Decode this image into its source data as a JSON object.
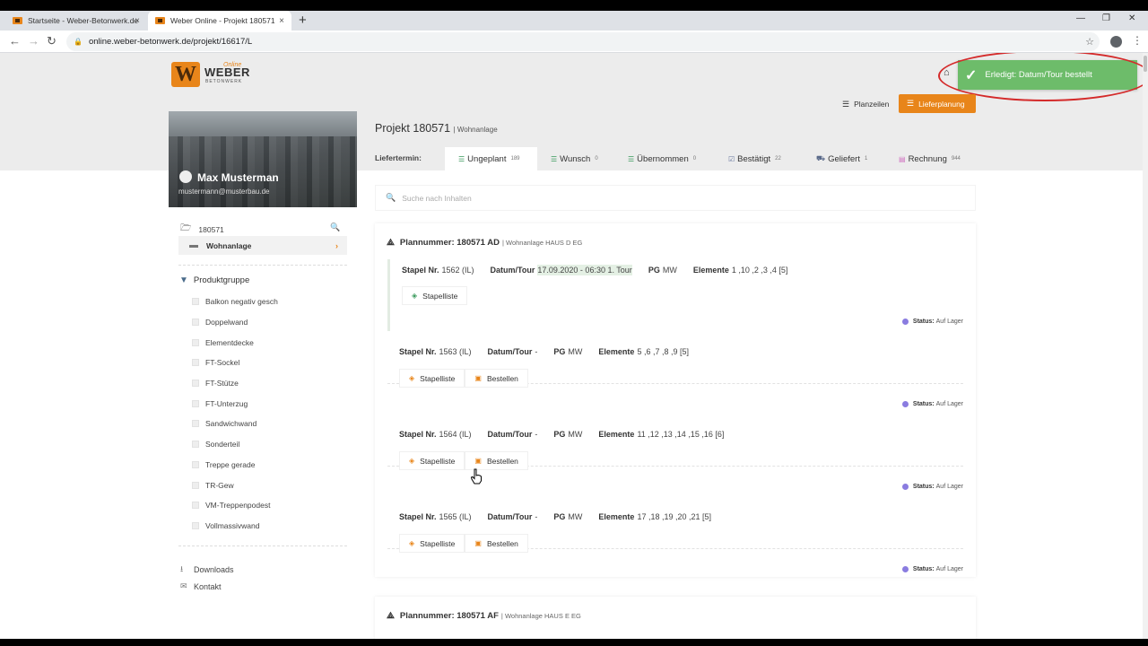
{
  "browser": {
    "tabs": [
      {
        "title": "Startseite - Weber-Betonwerk.de",
        "active": false
      },
      {
        "title": "Weber Online - Projekt 180571",
        "active": true
      }
    ],
    "url": "online.weber-betonwerk.de/projekt/16617/L",
    "new_tab_label": "+",
    "close_label": "×"
  },
  "brand": {
    "logo_letter": "W",
    "name": "WEBER",
    "online": "Online",
    "sub": "BETONWERK",
    "accent_color": "#e8851a"
  },
  "toast": {
    "message": "Erledigt: Datum/Tour bestellt",
    "color": "#6dbc6a"
  },
  "header_buttons": {
    "planzeilen": "Planzeilen",
    "lieferplanung": "Lieferplanung"
  },
  "user": {
    "name": "Max Musterman",
    "email": "mustermann@musterbau.de"
  },
  "sidebar": {
    "project": "180571",
    "subproject": "Wohnanlage",
    "group_title": "Produktgruppe",
    "filters": [
      "Balkon negativ gesch",
      "Doppelwand",
      "Elementdecke",
      "FT-Sockel",
      "FT-Stütze",
      "FT-Unterzug",
      "Sandwichwand",
      "Sonderteil",
      "Treppe gerade",
      "TR-Gew",
      "VM-Treppenpodest",
      "Vollmassivwand"
    ],
    "downloads": "Downloads",
    "kontakt": "Kontakt"
  },
  "main": {
    "project_title": "Projekt 180571",
    "project_sub": "| Wohnanlage",
    "liefertermin_label": "Liefertermin:",
    "status_tabs": [
      {
        "label": "Ungeplant",
        "count": "189",
        "icon": "stack-icon",
        "color": "#3a9a5c",
        "active": true
      },
      {
        "label": "Wunsch",
        "count": "0",
        "icon": "stack-icon",
        "color": "#3a9a5c",
        "active": false
      },
      {
        "label": "Übernommen",
        "count": "0",
        "icon": "stack-icon",
        "color": "#3a9a5c",
        "active": false
      },
      {
        "label": "Bestätigt",
        "count": "22",
        "icon": "checklist-icon",
        "color": "#6a7aa0",
        "active": false
      },
      {
        "label": "Geliefert",
        "count": "1",
        "icon": "truck-icon",
        "color": "#5a6a8a",
        "active": false
      },
      {
        "label": "Rechnung",
        "count": "944",
        "icon": "invoice-icon",
        "color": "#d070c0",
        "active": false
      }
    ],
    "search_placeholder": "Suche nach Inhalten",
    "plans": [
      {
        "title": "Plannummer: 180571 AD",
        "sub": "| Wohnanlage HAUS D EG",
        "stapel": [
          {
            "stapel_label": "Stapel Nr.",
            "stapel_value": "1562 (IL)",
            "datum_label": "Datum/Tour",
            "datum_value": "17.09.2020 - 06:30 1. Tour",
            "pg_label": "PG",
            "pg_value": "MW",
            "elem_label": "Elemente",
            "elem_value": "1 ,10 ,2 ,3 ,4 [5]",
            "buttons": [
              "Stapelliste"
            ],
            "status_label": "Status:",
            "status_value": "Auf Lager",
            "selected": true
          },
          {
            "stapel_label": "Stapel Nr.",
            "stapel_value": "1563 (IL)",
            "datum_label": "Datum/Tour",
            "datum_value": "-",
            "pg_label": "PG",
            "pg_value": "MW",
            "elem_label": "Elemente",
            "elem_value": "5 ,6 ,7 ,8 ,9 [5]",
            "buttons": [
              "Stapelliste",
              "Bestellen"
            ],
            "status_label": "Status:",
            "status_value": "Auf Lager",
            "selected": false
          },
          {
            "stapel_label": "Stapel Nr.",
            "stapel_value": "1564 (IL)",
            "datum_label": "Datum/Tour",
            "datum_value": "-",
            "pg_label": "PG",
            "pg_value": "MW",
            "elem_label": "Elemente",
            "elem_value": "11 ,12 ,13 ,14 ,15 ,16 [6]",
            "buttons": [
              "Stapelliste",
              "Bestellen"
            ],
            "status_label": "Status:",
            "status_value": "Auf Lager",
            "selected": false
          },
          {
            "stapel_label": "Stapel Nr.",
            "stapel_value": "1565 (IL)",
            "datum_label": "Datum/Tour",
            "datum_value": "-",
            "pg_label": "PG",
            "pg_value": "MW",
            "elem_label": "Elemente",
            "elem_value": "17 ,18 ,19 ,20 ,21 [5]",
            "buttons": [
              "Stapelliste",
              "Bestellen"
            ],
            "status_label": "Status:",
            "status_value": "Auf Lager",
            "selected": false
          }
        ]
      },
      {
        "title": "Plannummer: 180571 AF",
        "sub": "| Wohnanlage HAUS E EG",
        "stapel": []
      }
    ]
  }
}
